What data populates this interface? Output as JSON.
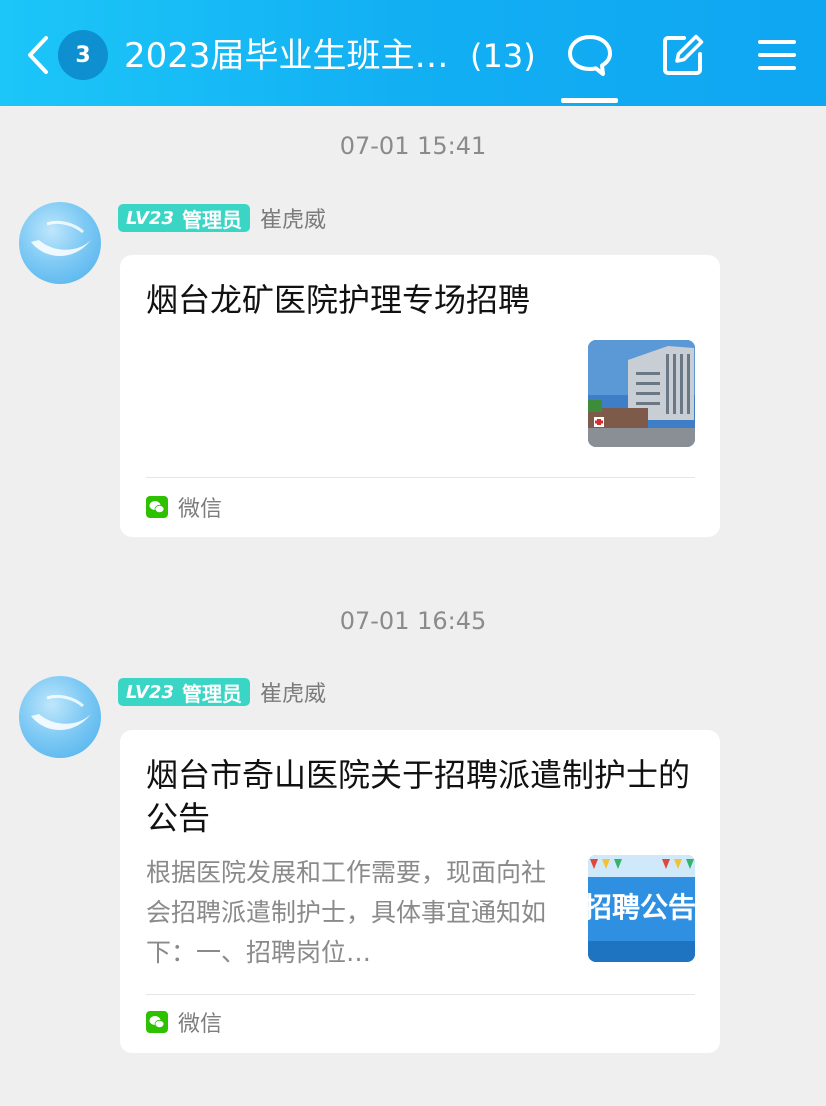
{
  "header": {
    "back_icon": "chevron-left-icon",
    "unread_badge": "3",
    "title": "2023届毕业生班主…",
    "member_count": "(13)",
    "chat_icon": "chat-bubble-icon",
    "edit_icon": "edit-icon",
    "menu_icon": "menu-icon"
  },
  "messages": [
    {
      "timestamp": "07-01 15:41",
      "level": "LV23",
      "role": "管理员",
      "sender": "崔虎威",
      "card_title": "烟台龙矿医院护理专场招聘",
      "card_desc": "",
      "source": "微信"
    },
    {
      "timestamp": "07-01 16:45",
      "level": "LV23",
      "role": "管理员",
      "sender": "崔虎威",
      "card_title": "烟台市奇山医院关于招聘派遣制护士的公告",
      "card_desc": "根据医院发展和工作需要，现面向社会招聘派遣制护士，具体事宜通知如下：一、招聘岗位…",
      "thumb_text": "招聘公告",
      "source": "微信"
    }
  ],
  "colors": {
    "header_gradient_start": "#1cc6f8",
    "header_gradient_end": "#0fa6f2",
    "level_tag": "#3bd5c5",
    "wechat_green": "#2dc100",
    "background": "#efefef"
  }
}
